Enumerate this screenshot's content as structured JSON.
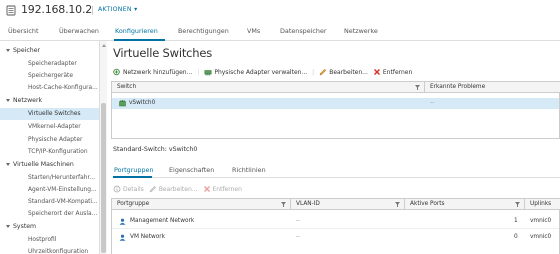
{
  "header": {
    "host_title": "192.168.10.2",
    "actions_label": "AKTIONEN ▾"
  },
  "tabs": [
    {
      "label": "Übersicht"
    },
    {
      "label": "Überwachen"
    },
    {
      "label": "Konfigurieren"
    },
    {
      "label": "Berechtigungen"
    },
    {
      "label": "VMs"
    },
    {
      "label": "Datenspeicher"
    },
    {
      "label": "Netzwerke"
    }
  ],
  "sidebar": {
    "groups": [
      {
        "label": "Speicher",
        "items": [
          "Speicheradapter",
          "Speichergeräte",
          "Host-Cache-Konfigura..."
        ]
      },
      {
        "label": "Netzwerk",
        "items": [
          "Virtuelle Switches",
          "VMkernel-Adapter",
          "Physische Adapter",
          "TCP/IP-Konfiguration"
        ]
      },
      {
        "label": "Virtuelle Maschinen",
        "items": [
          "Starten/Herunterfahr...",
          "Agent-VM-Einstellung...",
          "Standard-VM-Kompati...",
          "Speicherort der Ausla..."
        ]
      },
      {
        "label": "System",
        "items": [
          "Hostprofil",
          "Uhrzeitkonfiguration"
        ]
      }
    ],
    "active_item": "Virtuelle Switches"
  },
  "main": {
    "title": "Virtuelle Switches",
    "toolbar": {
      "add_network": "Netzwerk hinzufügen...",
      "manage_physical": "Physische Adapter verwalten...",
      "edit": "Bearbeiten...",
      "remove": "Entfernen"
    },
    "switch_grid": {
      "columns": [
        "Switch",
        "Erkannte Probleme"
      ],
      "rows": [
        {
          "name": "vSwitch0",
          "problems": "--"
        }
      ]
    },
    "section_label": "Standard-Switch: vSwitch0",
    "subtabs": [
      "Portgruppen",
      "Eigenschaften",
      "Richtlinien"
    ],
    "pg_toolbar": {
      "details": "Details",
      "edit": "Bearbeiten...",
      "remove": "Entfernen"
    },
    "portgroup_grid": {
      "columns": [
        "Portgruppe",
        "VLAN-ID",
        "Aktive Ports",
        "Uplinks"
      ],
      "rows": [
        {
          "name": "Management Network",
          "vlan": "--",
          "ports": "1",
          "uplinks": "vmnic0"
        },
        {
          "name": "VM Network",
          "vlan": "--",
          "ports": "0",
          "uplinks": "vmnic0"
        }
      ]
    }
  },
  "colors": {
    "accent": "#0072a3",
    "selection": "#d5e9f6",
    "remove_red": "#d93025"
  }
}
